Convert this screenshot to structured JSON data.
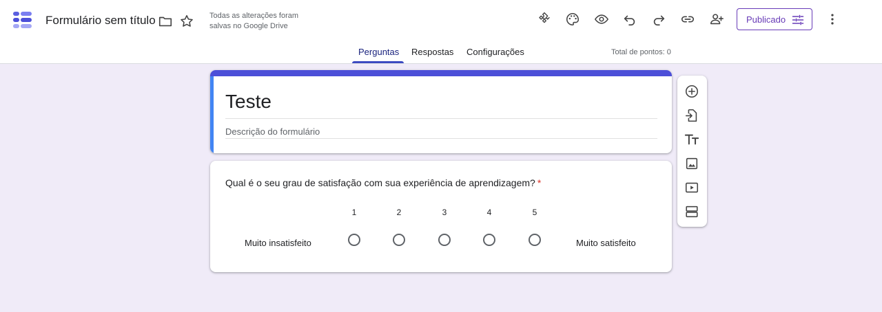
{
  "app": {
    "title": "Formulário sem título",
    "save_status": "Todas as alterações foram salvas no Google Drive",
    "accent_color": "#673ab7"
  },
  "header_icons": [
    "folder-icon",
    "star-icon",
    "addons-icon",
    "palette-icon",
    "preview-icon",
    "undo-icon",
    "redo-icon",
    "link-icon",
    "add-collaborator-icon",
    "more-vert-icon"
  ],
  "publish_button": {
    "label": "Publicado"
  },
  "tabs": [
    {
      "label": "Perguntas",
      "active": true
    },
    {
      "label": "Respostas",
      "active": false
    },
    {
      "label": "Configurações",
      "active": false
    }
  ],
  "points": "Total de pontos: 0",
  "form": {
    "title": "Teste",
    "description_placeholder": "Descrição do formulário"
  },
  "question": {
    "text": "Qual é o seu grau de satisfação com sua experiência de aprendizagem?",
    "required_mark": "*",
    "scale": [
      "1",
      "2",
      "3",
      "4",
      "5"
    ],
    "low_label": "Muito insatisfeito",
    "high_label": "Muito satisfeito"
  },
  "side_toolbar": [
    "add-question-icon",
    "import-questions-icon",
    "add-title-icon",
    "add-image-icon",
    "add-video-icon",
    "add-section-icon"
  ]
}
